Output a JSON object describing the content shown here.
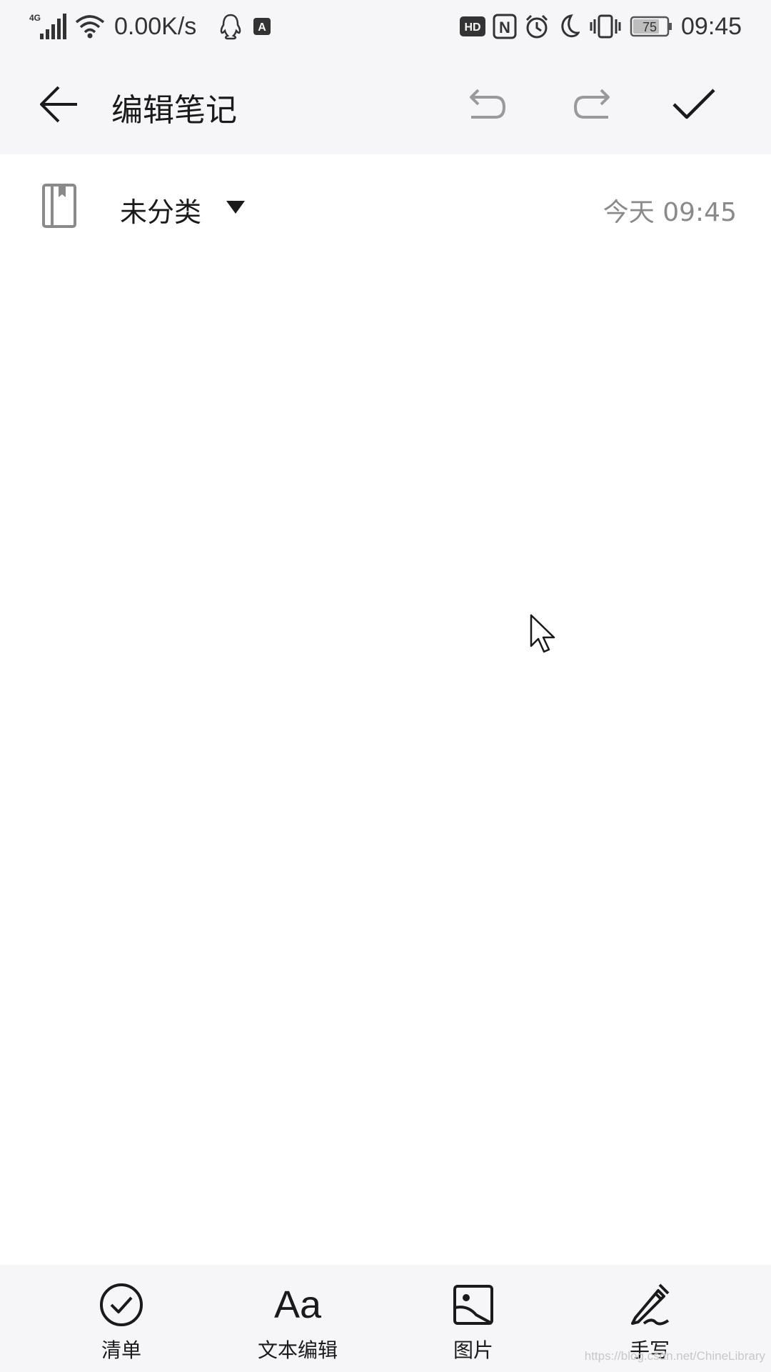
{
  "status_bar": {
    "network_type": "4G",
    "speed": "0.00K/s",
    "hd_label": "HD",
    "nfc_label": "N",
    "battery_level": "75",
    "time": "09:45",
    "icons": [
      "signal-icon",
      "wifi-icon",
      "qq-icon",
      "notification-a-icon",
      "hd-icon",
      "nfc-icon",
      "alarm-icon",
      "moon-icon",
      "vibrate-icon",
      "battery-icon"
    ]
  },
  "app_bar": {
    "title": "编辑笔记",
    "icons": [
      "back-arrow-icon",
      "undo-icon",
      "redo-icon",
      "check-icon"
    ]
  },
  "category_row": {
    "category": "未分类",
    "timestamp": "今天 09:45",
    "icons": [
      "notebook-icon",
      "dropdown-triangle-icon"
    ]
  },
  "editor": {
    "content": ""
  },
  "bottom_bar": {
    "tools": [
      {
        "label": "清单",
        "icon": "checklist-icon"
      },
      {
        "label": "文本编辑",
        "icon_text": "Aa",
        "icon": "text-format-icon"
      },
      {
        "label": "图片",
        "icon": "image-icon"
      },
      {
        "label": "手写",
        "icon": "handwriting-pen-icon"
      }
    ]
  },
  "watermark": "https://blog.csdn.net/ChineLibrary",
  "colors": {
    "bar_background": "#f6f6f8",
    "page_background": "#ffffff",
    "primary_text": "#1a1a1a",
    "secondary_text": "#8a8a8a",
    "icon_inactive": "#9a9a9a"
  }
}
